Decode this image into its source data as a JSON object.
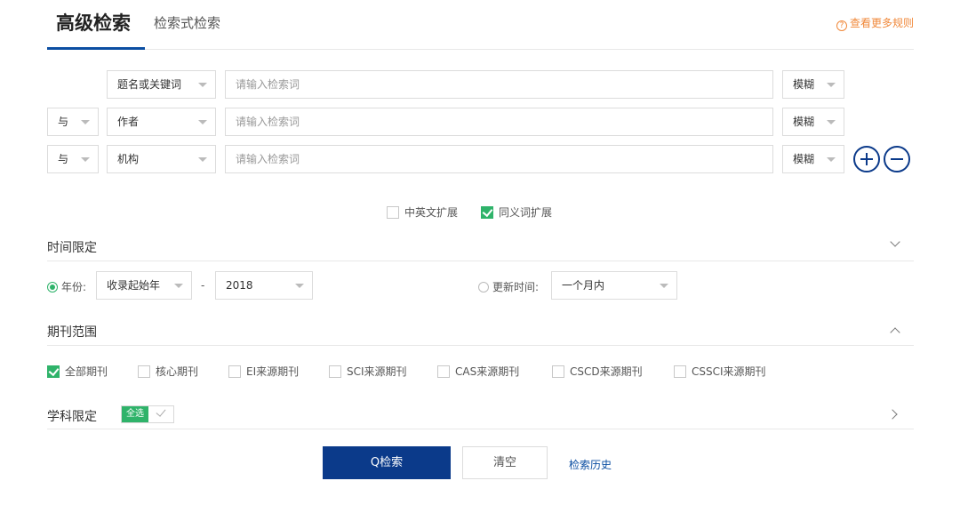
{
  "tabs": {
    "active": "高级检索",
    "other": "检索式检索"
  },
  "rules_link": "查看更多规则",
  "rows": [
    {
      "logic": "",
      "field": "题名或关键词",
      "placeholder": "请输入检索词",
      "match": "模糊"
    },
    {
      "logic": "与",
      "field": "作者",
      "placeholder": "请输入检索词",
      "match": "模糊"
    },
    {
      "logic": "与",
      "field": "机构",
      "placeholder": "请输入检索词",
      "match": "模糊"
    }
  ],
  "expansion": [
    {
      "label": "中英文扩展",
      "checked": false
    },
    {
      "label": "同义词扩展",
      "checked": true
    }
  ],
  "time_section": {
    "title": "时间限定",
    "year_label": "年份:",
    "year_from": "收录起始年",
    "dash": "-",
    "year_to": "2018",
    "update_label": "更新时间:",
    "update_value": "一个月内"
  },
  "journal_section": {
    "title": "期刊范围",
    "options": [
      {
        "label": "全部期刊",
        "checked": true
      },
      {
        "label": "核心期刊",
        "checked": false
      },
      {
        "label": "EI来源期刊",
        "checked": false
      },
      {
        "label": "SCI来源期刊",
        "checked": false
      },
      {
        "label": "CAS来源期刊",
        "checked": false
      },
      {
        "label": "CSCD来源期刊",
        "checked": false
      },
      {
        "label": "CSSCI来源期刊",
        "checked": false
      }
    ]
  },
  "subject_section": {
    "title": "学科限定",
    "select_all": "全选"
  },
  "buttons": {
    "search": "Q检索",
    "clear": "清空",
    "history": "检索历史"
  },
  "colors": {
    "primary": "#0b3a8a",
    "check": "#2fb36a",
    "rules": "#f0883a"
  }
}
